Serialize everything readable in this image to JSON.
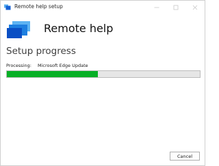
{
  "window": {
    "title": "Remote help setup",
    "app_icon": "remote-help-logo",
    "controls": {
      "minimize_icon": "minimize-icon",
      "maximize_icon": "maximize-icon",
      "close_icon": "close-icon"
    }
  },
  "header": {
    "app_name": "Remote help"
  },
  "main": {
    "heading": "Setup progress",
    "status_label": "Processing:",
    "status_value": "Microsoft Edge Update",
    "progress_fraction": 0.47
  },
  "footer": {
    "cancel_label": "Cancel"
  },
  "colors": {
    "accent": "#0078d4",
    "progress": "#06b025"
  }
}
